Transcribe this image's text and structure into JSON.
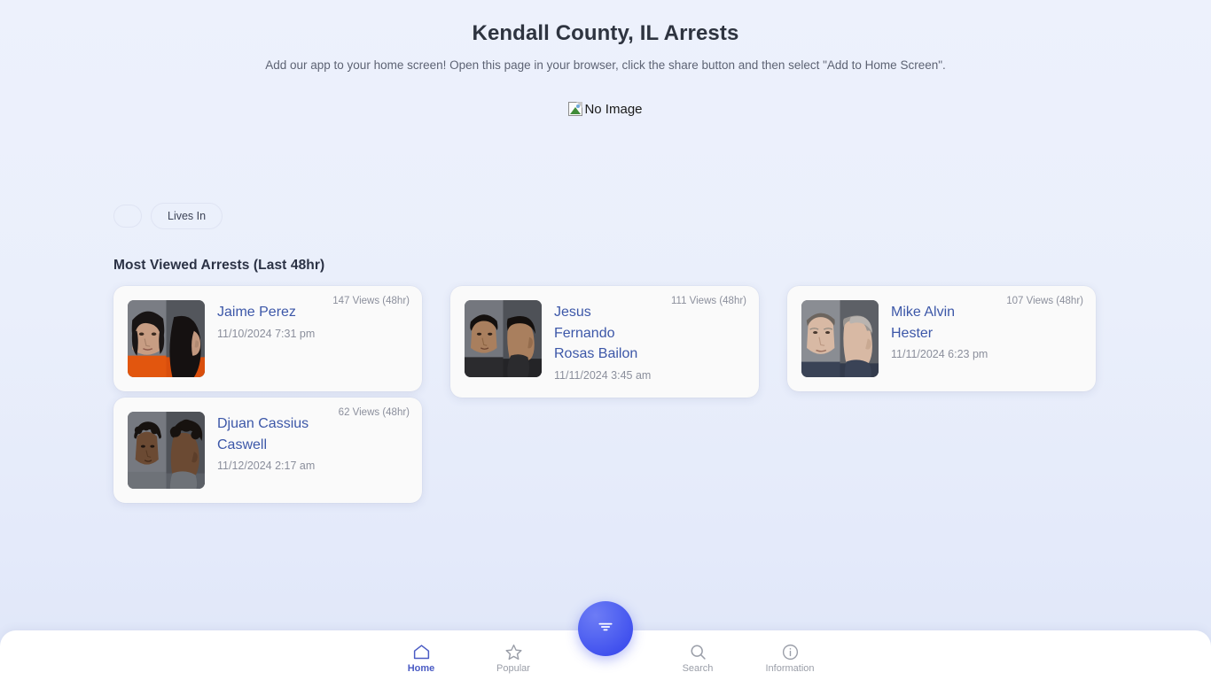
{
  "header": {
    "title": "Kendall County, IL Arrests",
    "subtitle": "Add our app to your home screen! Open this page in your browser, click the share button and then select \"Add to Home Screen\"."
  },
  "banner": {
    "alt_text": "No Image",
    "icon": "broken-image-icon"
  },
  "filters": {
    "empty_pill_label": "",
    "pills": [
      {
        "label": "Lives In"
      }
    ]
  },
  "main": {
    "section_title": "Most Viewed Arrests (Last 48hr)",
    "arrests": [
      {
        "name": "Jaime Perez",
        "date": "11/10/2024 7:31 pm",
        "views": "147 Views (48hr)",
        "mugshot": "mugshot-jaime-perez"
      },
      {
        "name": "Jesus Fernando Rosas Bailon",
        "date": "11/11/2024 3:45 am",
        "views": "111 Views (48hr)",
        "mugshot": "mugshot-jesus-fernando-rosas-bailon"
      },
      {
        "name": "Mike Alvin Hester",
        "date": "11/11/2024 6:23 pm",
        "views": "107 Views (48hr)",
        "mugshot": "mugshot-mike-alvin-hester"
      },
      {
        "name": "Djuan Cassius Caswell",
        "date": "11/12/2024 2:17 am",
        "views": "62 Views (48hr)",
        "mugshot": "mugshot-djuan-cassius-caswell"
      }
    ]
  },
  "bottom_nav": {
    "items": [
      {
        "label": "Home",
        "icon": "home-icon",
        "active": true
      },
      {
        "label": "Popular",
        "icon": "star-icon",
        "active": false
      },
      {
        "label": "Search",
        "icon": "search-icon",
        "active": false
      },
      {
        "label": "Information",
        "icon": "info-icon",
        "active": false
      }
    ],
    "fab": {
      "icon": "filter-funnel-icon"
    }
  },
  "colors": {
    "accent": "#4a5bc4",
    "link": "#3c57a8",
    "fab_gradient_start": "#6d7cf5",
    "fab_gradient_end": "#3b3fe8",
    "muted_text": "#8b8f9c",
    "card_bg": "#fafafa",
    "page_bg_top": "#edf1fc",
    "page_bg_bottom": "#dfe6f8"
  }
}
